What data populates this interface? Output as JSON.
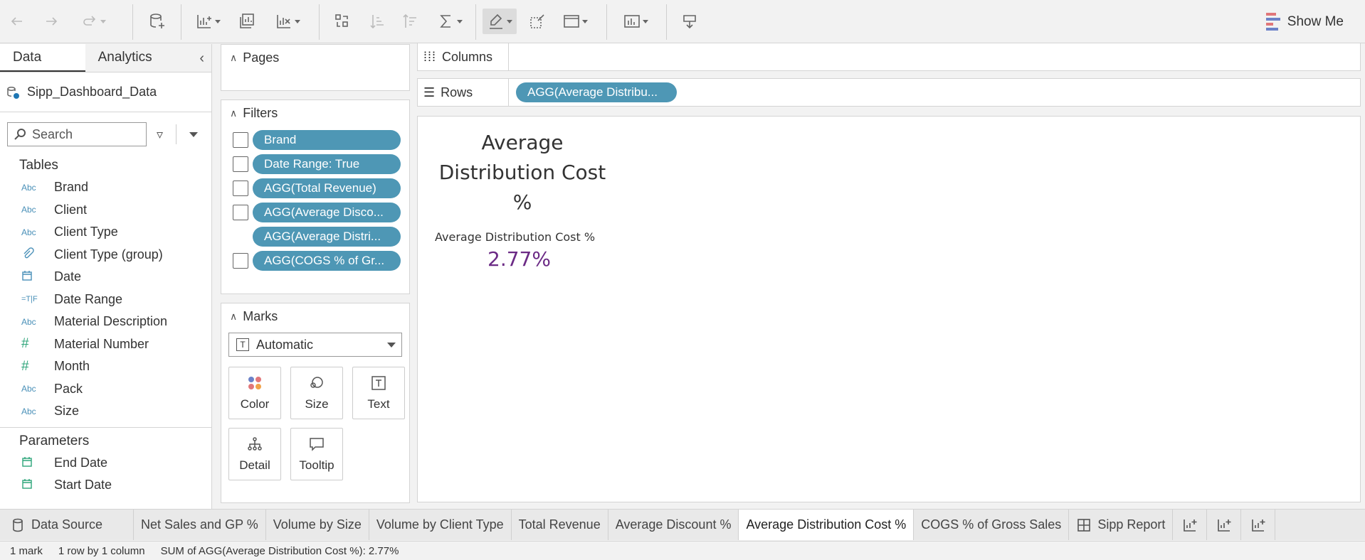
{
  "toolbar": {
    "icons": [
      "back-icon",
      "forward-icon",
      "redo-icon",
      "new-data-source-icon",
      "new-worksheet-icon",
      "duplicate-sheet-icon",
      "clear-sheet-icon",
      "swap-rows-columns-icon",
      "sort-ascending-icon",
      "sort-descending-icon",
      "totals-icon",
      "highlight-icon",
      "format-icon",
      "fit-icon",
      "show-labels-icon",
      "presentation-icon"
    ],
    "show_me": "Show Me",
    "show_me_colors": [
      "#e1777a",
      "#6c82c8",
      "#4e79a7"
    ]
  },
  "data_pane": {
    "tabs": [
      "Data",
      "Analytics"
    ],
    "data_source": "Sipp_Dashboard_Data",
    "search_placeholder": "Search",
    "tables_heading": "Tables",
    "fields": [
      {
        "type": "Abc",
        "name": "Brand"
      },
      {
        "type": "Abc",
        "name": "Client"
      },
      {
        "type": "Abc",
        "name": "Client Type"
      },
      {
        "type": "paperclip",
        "name": "Client Type (group)"
      },
      {
        "type": "calendar",
        "name": "Date"
      },
      {
        "type": "=T|F",
        "name": "Date Range"
      },
      {
        "type": "Abc",
        "name": "Material Description"
      },
      {
        "type": "#",
        "name": "Material Number"
      },
      {
        "type": "#",
        "name": "Month"
      },
      {
        "type": "Abc",
        "name": "Pack"
      },
      {
        "type": "Abc",
        "name": "Size"
      }
    ],
    "parameters_heading": "Parameters",
    "parameters": [
      {
        "type": "calendar",
        "name": "End Date"
      },
      {
        "type": "calendar",
        "name": "Start Date"
      }
    ]
  },
  "cards": {
    "pages_title": "Pages",
    "filters_title": "Filters",
    "filters": [
      "Brand",
      "Date Range: True",
      "AGG(Total Revenue)",
      "AGG(Average Disco...",
      "AGG(Average Distri...",
      "AGG(COGS % of Gr..."
    ],
    "marks_title": "Marks",
    "mark_type": "Automatic",
    "mark_buttons": [
      "Color",
      "Size",
      "Text",
      "Detail",
      "Tooltip"
    ]
  },
  "shelves": {
    "columns_label": "Columns",
    "rows_label": "Rows",
    "rows_pill": "AGG(Average Distribu..."
  },
  "viz": {
    "title_lines": [
      "Average",
      "Distribution Cost",
      "%"
    ],
    "measure_label": "Average Distribution Cost %",
    "measure_value": "2.77%",
    "value_color": "#6b2a85"
  },
  "sheet_tabs": [
    "Data Source",
    "Net Sales and GP %",
    "Volume by Size",
    "Volume by Client Type",
    "Total Revenue",
    "Average Discount %",
    "Average Distribution Cost %",
    "COGS % of Gross Sales",
    "Sipp Report"
  ],
  "active_sheet": "Average Distribution Cost %",
  "status": {
    "marks": "1 mark",
    "dims": "1 row by 1 column",
    "sum": "SUM of AGG(Average Distribution Cost %): 2.77%"
  }
}
